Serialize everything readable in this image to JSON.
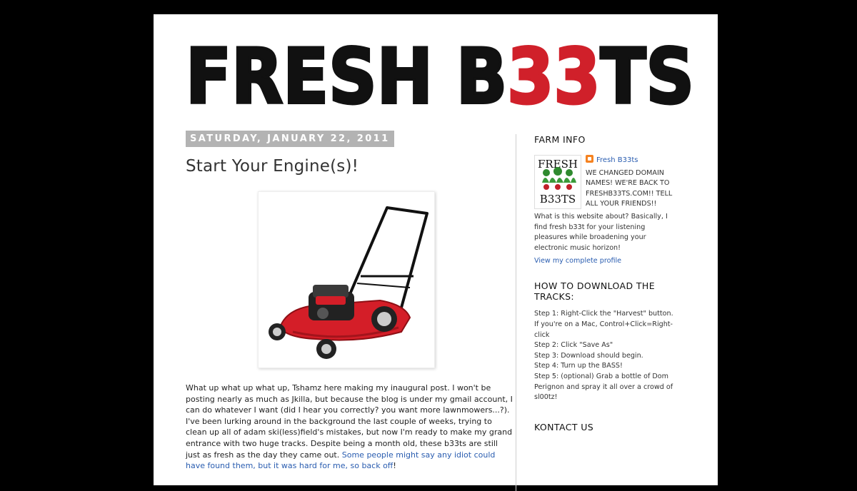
{
  "blog": {
    "title_part1": "FRESH B",
    "title_part2": "33",
    "title_part3": "TS"
  },
  "post": {
    "date": "SATURDAY, JANUARY 22, 2011",
    "title": "Start Your Engine(s)!",
    "body_text": "What up what up what up, Tshamz here making my inaugural post.  I won't be posting nearly as much as Jkilla, but because the blog is under my gmail account, I can do whatever I want (did I hear you correctly?  you want more lawnmowers...?).  I've been lurking around in the background the last couple of weeks, trying to clean up all of adam ski(less)field's mistakes, but now I'm ready to make my grand entrance with two huge tracks.  Despite being a month old, these b33ts are still just as fresh as the day they came out. ",
    "body_link": "Some people might say any idiot could have found them, but it was hard for me, so back off",
    "body_end": "!",
    "image_alt": "red lawn mower"
  },
  "sidebar": {
    "farm_info_heading": "FARM INFO",
    "profile_name": "Fresh B33ts",
    "profile_img_top": "FRESH",
    "profile_img_bottom": "B33TS",
    "profile_text": "WE CHANGED DOMAIN NAMES! WE'RE BACK TO FRESHB33TS.COM!! TELL ALL YOUR FRIENDS!!",
    "profile_about": "What is this website about? Basically, I find fresh b33t for your listening pleasures while broadening your electronic music horizon!",
    "profile_link": "View my complete profile",
    "howto_heading": "HOW TO DOWNLOAD THE TRACKS:",
    "steps": [
      "Step 1: Right-Click the \"Harvest\" button. If you're on a Mac, Control+Click=Right-click",
      "Step 2: Click \"Save As\"",
      "Step 3: Download should begin.",
      "Step 4: Turn up the BASS!",
      "Step 5: (optional) Grab a bottle of Dom Perignon and spray it all over a crowd of sl00tz!"
    ],
    "contact_heading": "KONTACT US"
  },
  "colors": {
    "background": "#000000",
    "page": "#ffffff",
    "logo_black": "#111111",
    "logo_red": "#d0202a",
    "date_bg": "#b3b3b3",
    "link": "#2a5db0"
  }
}
